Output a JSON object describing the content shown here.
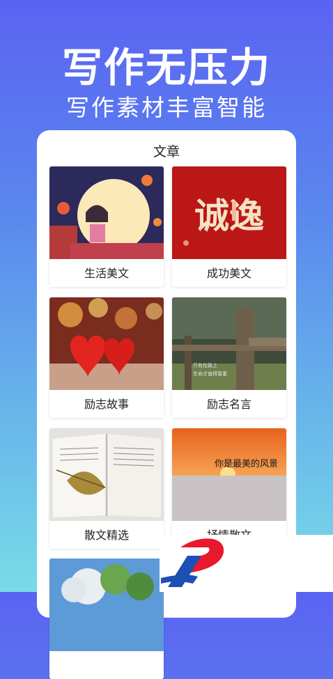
{
  "hero": {
    "title": "写作无压力",
    "subtitle": "写作素材丰富智能"
  },
  "panel": {
    "title": "文章"
  },
  "categories": [
    {
      "label": "生活美文",
      "image": "moon-girl-illustration"
    },
    {
      "label": "成功美文",
      "image": "red-calligraphy"
    },
    {
      "label": "励志故事",
      "image": "red-hearts-bokeh"
    },
    {
      "label": "励志名言",
      "image": "wooden-fence"
    },
    {
      "label": "散文精选",
      "image": "open-book-leaf"
    },
    {
      "label": "抒情散文",
      "image": "sunset-sea-clouds"
    },
    {
      "label": "",
      "image": "tree-blue-sky"
    }
  ],
  "thumbnail_text": {
    "calligraphy": "诚逸",
    "fence_caption_1": "只有在路上",
    "fence_caption_2": "生命才值得尊重",
    "sunset_script": "你是最美的风景"
  }
}
